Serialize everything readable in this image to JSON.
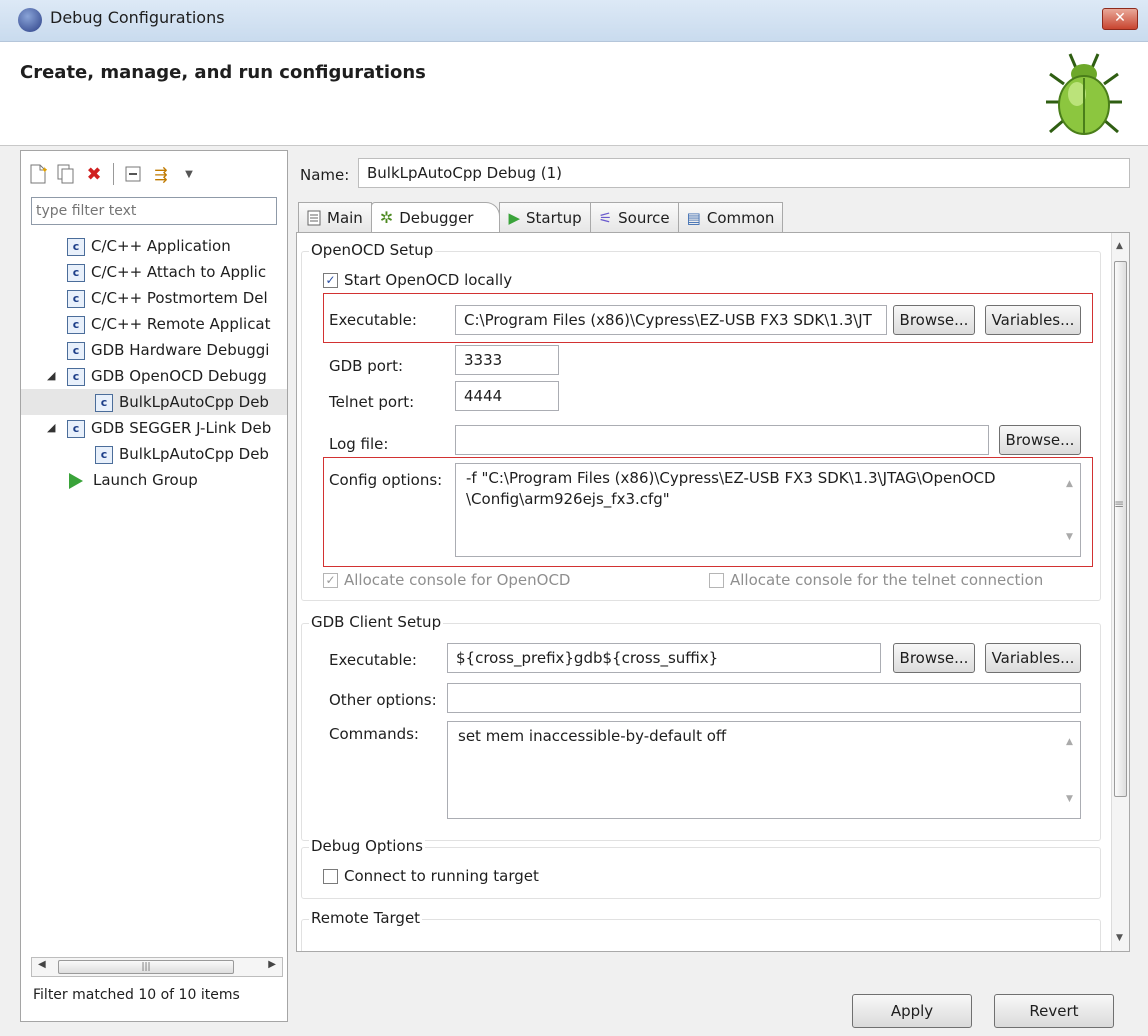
{
  "window": {
    "title": "Debug Configurations",
    "close_label": "✕"
  },
  "banner": {
    "title": "Create, manage, and run configurations"
  },
  "left": {
    "filter_placeholder": "type filter text",
    "tree": [
      {
        "label": "C/C++ Application",
        "level": 1,
        "icon": "c-config-icon"
      },
      {
        "label": "C/C++ Attach to Applic",
        "level": 1,
        "icon": "c-config-icon"
      },
      {
        "label": "C/C++ Postmortem Del",
        "level": 1,
        "icon": "c-config-icon"
      },
      {
        "label": "C/C++ Remote Applicat",
        "level": 1,
        "icon": "c-config-icon"
      },
      {
        "label": "GDB Hardware Debuggi",
        "level": 1,
        "icon": "c-config-icon"
      },
      {
        "label": "GDB OpenOCD Debugg",
        "level": 1,
        "icon": "c-config-icon",
        "expanded": true
      },
      {
        "label": "BulkLpAutoCpp Deb",
        "level": 2,
        "icon": "c-config-icon",
        "selected": true
      },
      {
        "label": "GDB SEGGER J-Link Deb",
        "level": 1,
        "icon": "c-config-icon",
        "expanded": true
      },
      {
        "label": "BulkLpAutoCpp Deb",
        "level": 2,
        "icon": "c-config-icon"
      },
      {
        "label": "Launch Group",
        "level": 1,
        "icon": "launch-group-icon"
      }
    ],
    "status": "Filter matched 10 of 10 items"
  },
  "right": {
    "name_label": "Name:",
    "name_value": "BulkLpAutoCpp Debug (1)",
    "tabs": [
      "Main",
      "Debugger",
      "Startup",
      "Source",
      "Common"
    ],
    "active_tab": "Debugger",
    "openocd": {
      "title": "OpenOCD Setup",
      "start_locally": "Start OpenOCD locally",
      "executable_label": "Executable:",
      "executable_value": "C:\\Program Files (x86)\\Cypress\\EZ-USB FX3 SDK\\1.3\\JT",
      "browse": "Browse...",
      "variables": "Variables...",
      "gdb_port_label": "GDB port:",
      "gdb_port_value": "3333",
      "telnet_port_label": "Telnet port:",
      "telnet_port_value": "4444",
      "log_file_label": "Log file:",
      "log_file_value": "",
      "config_label": "Config options:",
      "config_line1": "-f \"C:\\Program Files (x86)\\Cypress\\EZ-USB FX3 SDK\\1.3\\JTAG\\OpenOCD",
      "config_line2": "\\Config\\arm926ejs_fx3.cfg\"",
      "alloc_openocd": "Allocate console for OpenOCD",
      "alloc_telnet": "Allocate console for the telnet connection"
    },
    "gdb_client": {
      "title": "GDB Client Setup",
      "executable_label": "Executable:",
      "executable_value": "${cross_prefix}gdb${cross_suffix}",
      "browse": "Browse...",
      "variables": "Variables...",
      "other_label": "Other options:",
      "other_value": "",
      "commands_label": "Commands:",
      "commands_value": "set mem inaccessible-by-default off"
    },
    "debug_options": {
      "title": "Debug Options",
      "connect": "Connect to running target"
    },
    "remote_target": {
      "title": "Remote Target"
    },
    "apply": "Apply",
    "revert": "Revert"
  }
}
